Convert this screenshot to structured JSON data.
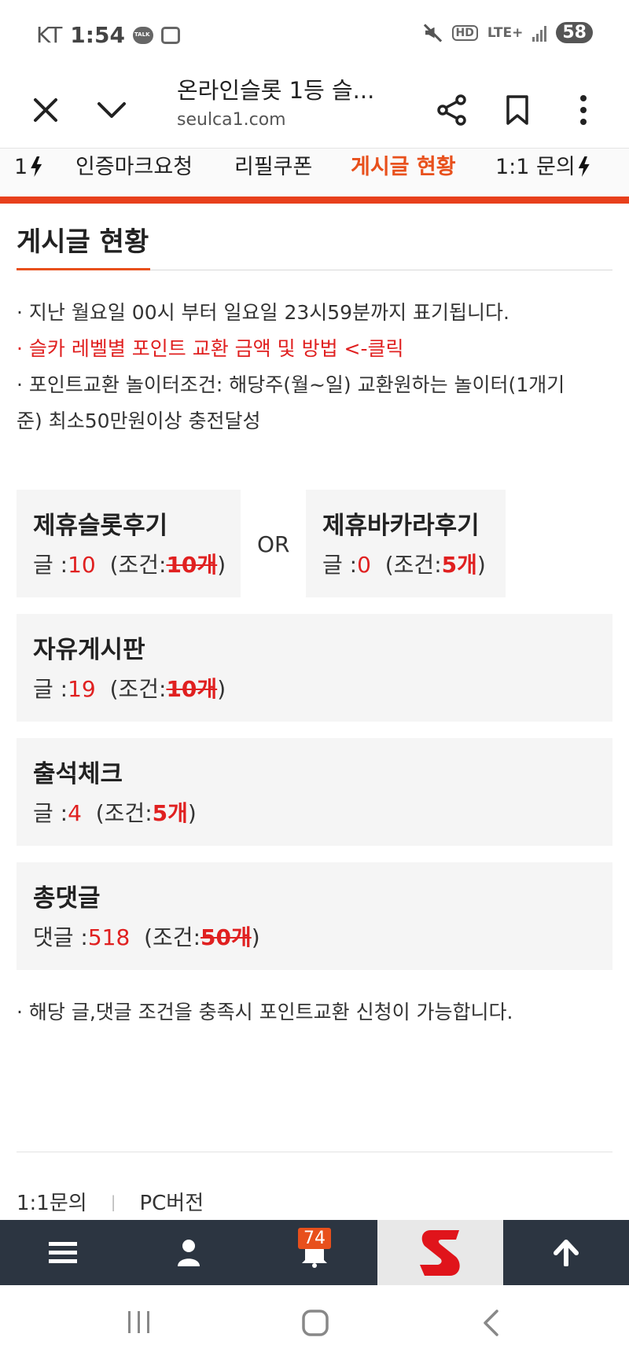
{
  "status_bar": {
    "carrier": "KT",
    "time": "1:54",
    "network": "LTE+",
    "hd": "HD",
    "battery": "58"
  },
  "browser": {
    "page_title": "온라인슬롯 1등 슬...",
    "url": "seulca1.com"
  },
  "nav_tabs": {
    "partial_left": "1",
    "items": [
      {
        "label": "인증마크요청"
      },
      {
        "label": "리필쿠폰"
      },
      {
        "label": "게시글 현황",
        "active": true
      },
      {
        "label": "1:1 문의"
      }
    ]
  },
  "section": {
    "title": "게시글 현황"
  },
  "notices": {
    "line1": "· 지난 월요일 00시 부터 일요일 23시59분까지 표기됩니다.",
    "line2": "· 슬카 레벨별 포인트 교환 금액 및 방법 <-클릭",
    "line3a": "· 포인트교환 놀이터조건: 해당주(월~일) 교환원하는 놀이터(1개기",
    "line3b": "준) 최소50만원이상 충전달성",
    "bottom": "· 해당 글,댓글 조건을 충족시 포인트교환 신청이 가능합니다."
  },
  "cards": {
    "or_label": "OR",
    "slot_review": {
      "title": "제휴슬롯후기",
      "label": "글 :",
      "count": "10",
      "cond_prefix": "(조건:",
      "cond_value": "10개",
      "cond_suffix": ")"
    },
    "baccarat_review": {
      "title": "제휴바카라후기",
      "label": "글 :",
      "count": "0",
      "cond_prefix": "(조건:",
      "cond_value": "5개",
      "cond_suffix": ")"
    },
    "free_board": {
      "title": "자유게시판",
      "label": "글 :",
      "count": "19",
      "cond_prefix": "(조건:",
      "cond_value": "10개",
      "cond_suffix": ")"
    },
    "attendance": {
      "title": "출석체크",
      "label": "글 :",
      "count": "4",
      "cond_prefix": "(조건:",
      "cond_value": "5개",
      "cond_suffix": ")"
    },
    "total_comments": {
      "title": "총댓글",
      "label": "댓글 :",
      "count": "518",
      "cond_prefix": "(조건:",
      "cond_value": "50개",
      "cond_suffix": ")"
    }
  },
  "footer": {
    "link1": "1:1문의",
    "separator": "|",
    "link2": "PC버전"
  },
  "app_bar": {
    "notification_count": "74",
    "icons": [
      "menu-icon",
      "user-icon",
      "bell-icon",
      "logo",
      "arrow-up-icon"
    ]
  },
  "colors": {
    "accent": "#e8501c",
    "red": "#e02020",
    "appbar": "#2c3541"
  }
}
